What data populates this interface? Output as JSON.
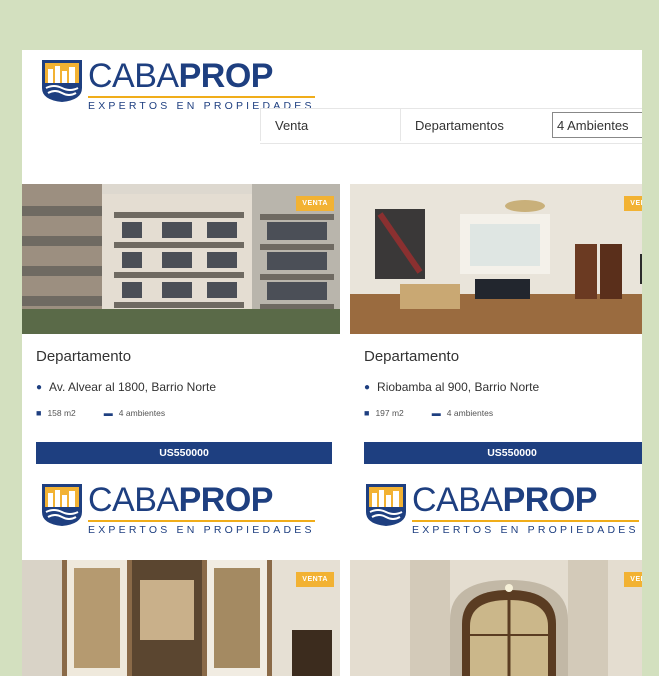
{
  "brand": {
    "name_thin": "CABA",
    "name_bold": "PROP",
    "tagline": "EXPERTOS EN PROPIEDADES"
  },
  "search": {
    "operation": "Venta",
    "type": "Departamentos",
    "rooms": "4 Ambientes"
  },
  "colors": {
    "brand_blue": "#1e3f80",
    "accent_gold": "#f2b233",
    "background_green": "#d3e0bf"
  },
  "listings": [
    {
      "badge": "VENTA",
      "title": "Departamento",
      "address": "Av. Alvear al 1800, Barrio Norte",
      "area": "158 m2",
      "rooms": "4 ambientes",
      "price": "US550000"
    },
    {
      "badge": "VENTA",
      "title": "Departamento",
      "address": "Riobamba al 900, Barrio Norte",
      "area": "197 m2",
      "rooms": "4 ambientes",
      "price": "US550000"
    },
    {
      "badge": "VENTA"
    },
    {
      "badge": "VENTA"
    }
  ],
  "icons": [
    "pin-icon",
    "cube-icon",
    "bed-icon",
    "city-logo-icon"
  ]
}
